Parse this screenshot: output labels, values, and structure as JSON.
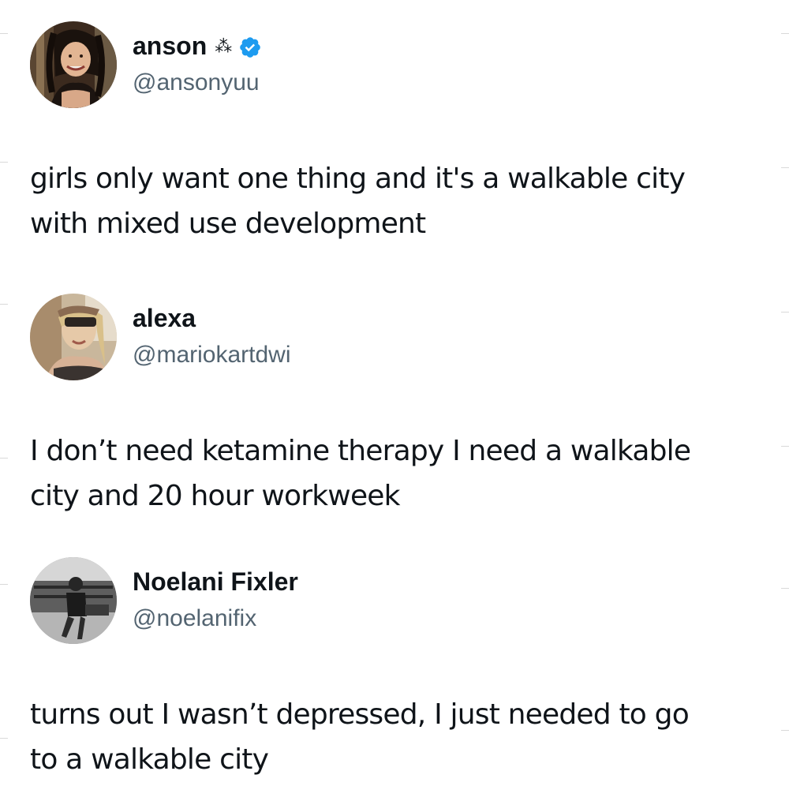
{
  "posts": [
    {
      "display_name": "anson",
      "name_emoji": "⁂",
      "verified": true,
      "handle": "@ansonyuu",
      "text_lines": [
        "girls only want one thing and it's a walkable city",
        "with mixed use development"
      ]
    },
    {
      "display_name": "alexa",
      "verified": false,
      "handle": "@mariokartdwi",
      "text_lines": [
        "I don’t need ketamine therapy I need a walkable",
        "city and 20 hour workweek"
      ]
    },
    {
      "display_name": "Noelani Fixler",
      "verified": false,
      "handle": "@noelanifix",
      "text_lines": [
        "turns out I wasn’t depressed, I just needed to go",
        "to a walkable city"
      ]
    }
  ],
  "colors": {
    "text_primary": "#0f1419",
    "text_secondary": "#536471",
    "verified_badge": "#1d9bf0",
    "background": "#ffffff"
  },
  "icons": {
    "verified": "verified-badge-icon",
    "name_emoji": "sparkles-icon"
  }
}
